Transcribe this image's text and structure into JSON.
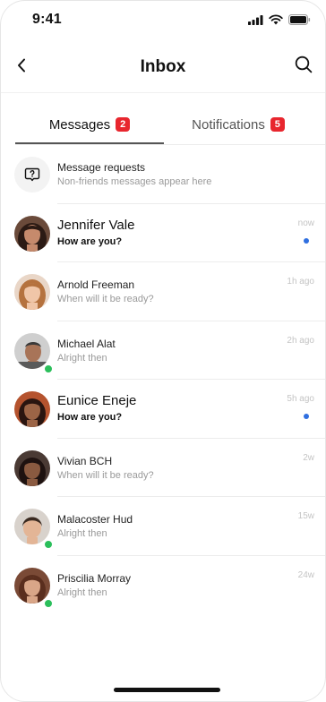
{
  "status_bar": {
    "time": "9:41"
  },
  "header": {
    "title": "Inbox",
    "back_icon": "chevron-left-icon",
    "search_icon": "search-icon"
  },
  "tabs": [
    {
      "label": "Messages",
      "badge": "2",
      "active": true
    },
    {
      "label": "Notifications",
      "badge": "5",
      "active": false
    }
  ],
  "colors": {
    "badge": "#e8262e",
    "unread_dot": "#2f6fe0",
    "online": "#2bbf5b"
  },
  "message_requests": {
    "title": "Message requests",
    "subtitle": "Non-friends messages appear here",
    "icon": "question-bubble-icon"
  },
  "conversations": [
    {
      "name": "Jennifer Vale",
      "preview": "How are you?",
      "time": "now",
      "unread": true,
      "online": false
    },
    {
      "name": "Arnold Freeman",
      "preview": "When will it be ready?",
      "time": "1h ago",
      "unread": false,
      "online": false
    },
    {
      "name": "Michael Alat",
      "preview": "Alright then",
      "time": "2h ago",
      "unread": false,
      "online": true
    },
    {
      "name": "Eunice Eneje",
      "preview": "How are you?",
      "time": "5h ago",
      "unread": true,
      "online": false
    },
    {
      "name": "Vivian BCH",
      "preview": "When will it be ready?",
      "time": "2w",
      "unread": false,
      "online": false
    },
    {
      "name": "Malacoster Hud",
      "preview": "Alright then",
      "time": "15w",
      "unread": false,
      "online": true
    },
    {
      "name": "Priscilia Morray",
      "preview": "Alright then",
      "time": "24w",
      "unread": false,
      "online": true
    }
  ]
}
